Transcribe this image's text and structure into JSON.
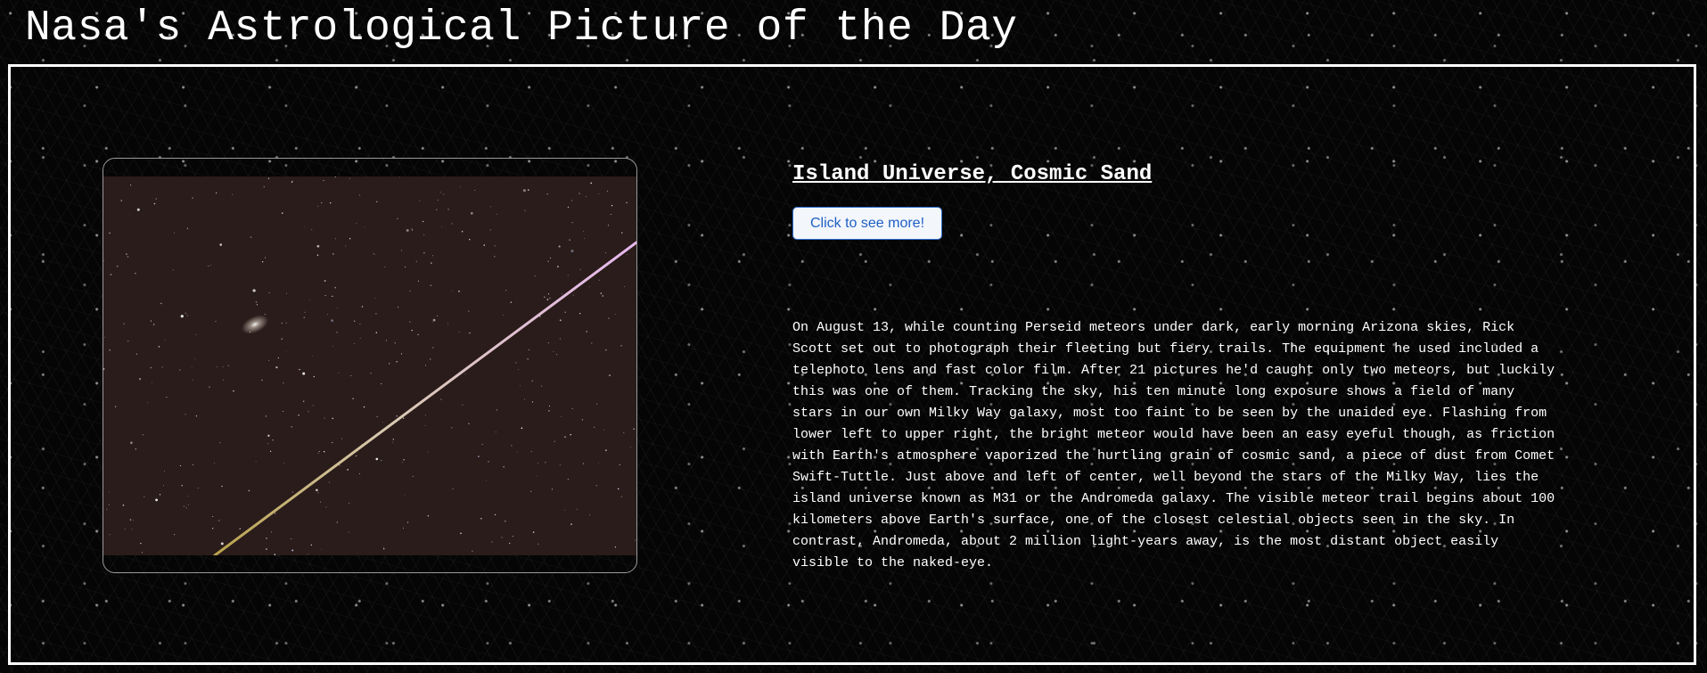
{
  "header": {
    "title": "Nasa's Astrological Picture of the Day"
  },
  "apod": {
    "title": "Island Universe, Cosmic Sand",
    "button_label": "Click to see more!",
    "explanation_lines": [
      "On August 13, while counting Perseid meteors under dark, early morning Arizona skies, Rick",
      "Scott set out to photograph their fleeting but fiery trails. The equipment he used included a",
      "telephoto lens and fast color film. After 21 pictures he'd caught only two meteors, but luckily",
      "this was one of them. Tracking the sky, his ten minute long exposure shows a field of many",
      "stars in our own Milky Way galaxy, most too faint to be seen by the unaided eye. Flashing from",
      "lower left to upper right, the bright meteor would have been an easy eyeful though, as friction",
      "with Earth's atmosphere vaporized the hurtling grain of cosmic sand, a piece of dust from Comet",
      "Swift-Tuttle. Just above and left of center, well beyond the stars of the Milky Way, lies the",
      "island universe known as M31 or the Andromeda galaxy. The visible meteor trail begins about 100",
      "kilometers above Earth's surface, one of the closest celestial objects seen in the sky. In",
      "contrast, Andromeda, about 2 million light-years away, is the most distant object easily",
      "visible to the naked-eye."
    ]
  },
  "colors": {
    "background": "#050505",
    "text": "#ffffff",
    "button_text": "#1f5fc6",
    "button_border": "#2f6fd1",
    "photo_sky": "#2a1c1a"
  }
}
